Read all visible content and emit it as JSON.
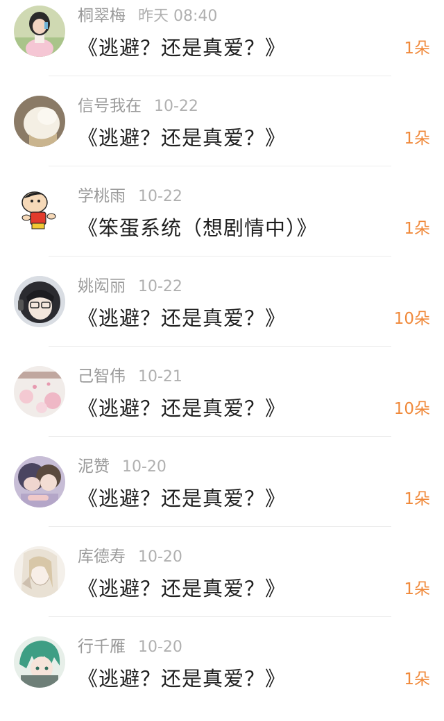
{
  "gift_list": {
    "items": [
      {
        "name": "桐翠梅",
        "time": "昨天 08:40",
        "title": "《逃避？还是真爱？》",
        "count": "1朵",
        "avatar_icon": "girl-photo-avatar"
      },
      {
        "name": "信号我在",
        "time": "10-22",
        "title": "《逃避？还是真爱？》",
        "count": "1朵",
        "avatar_icon": "cream-avatar"
      },
      {
        "name": "学桃雨",
        "time": "10-22",
        "title": "《笨蛋系统（想剧情中）》",
        "count": "1朵",
        "avatar_icon": "cartoon-boy-avatar"
      },
      {
        "name": "姚闳丽",
        "time": "10-22",
        "title": "《逃避？还是真爱？》",
        "count": "10朵",
        "avatar_icon": "anime-glasses-avatar"
      },
      {
        "name": "己智伟",
        "time": "10-21",
        "title": "《逃避？还是真爱？》",
        "count": "10朵",
        "avatar_icon": "blossom-scenery-avatar"
      },
      {
        "name": "泥赞",
        "time": "10-20",
        "title": "《逃避？还是真爱？》",
        "count": "1朵",
        "avatar_icon": "anime-couple-avatar"
      },
      {
        "name": "库德寿",
        "time": "10-20",
        "title": "《逃避？还是真爱？》",
        "count": "1朵",
        "avatar_icon": "sketch-girl-avatar"
      },
      {
        "name": "行千雁",
        "time": "10-20",
        "title": "《逃避？还是真爱？》",
        "count": "1朵",
        "avatar_icon": "green-hair-anime-avatar"
      }
    ]
  },
  "colors": {
    "count_accent": "#f0893a",
    "name_gray": "#9a9a9a",
    "title_text": "#1f1f1f",
    "divider": "#ececec"
  }
}
